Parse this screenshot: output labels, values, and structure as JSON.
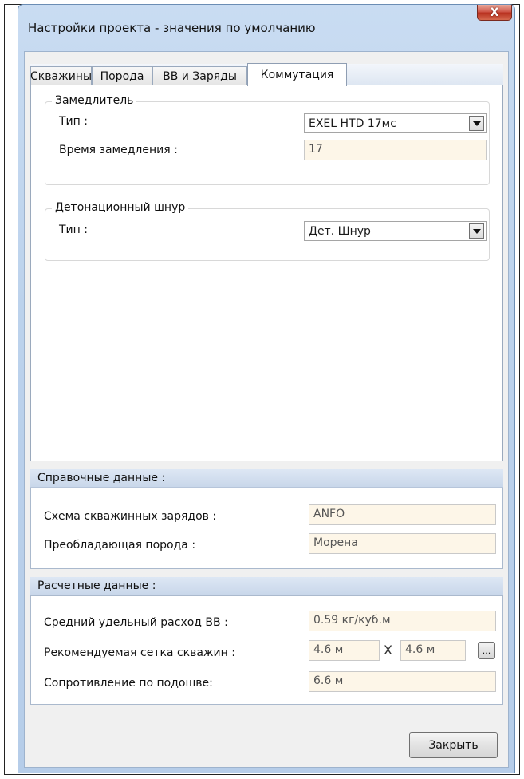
{
  "window": {
    "title": "Настройки проекта - значения по умолчанию",
    "close_glyph": "X"
  },
  "tabs": [
    {
      "label": "Скважины"
    },
    {
      "label": "Порода"
    },
    {
      "label": "ВВ и Заряды"
    },
    {
      "label": "Коммутация",
      "active": true
    }
  ],
  "delay_group": {
    "legend": "Замедлитель",
    "type_label": "Тип :",
    "type_value": "EXEL HTD 17мс",
    "delay_label": "Время замедления :",
    "delay_value": "17"
  },
  "cord_group": {
    "legend": "Детонационный шнур",
    "type_label": "Тип :",
    "type_value": "Дет. Шнур"
  },
  "reference": {
    "header": "Справочные  данные :",
    "charge_scheme_label": "Схема скважинных зарядов :",
    "charge_scheme_value": "ANFO",
    "rock_label": "Преобладающая порода :",
    "rock_value": "Морена"
  },
  "calculated": {
    "header": "Расчетные  данные :",
    "consumption_label": "Средний удельный расход ВВ :",
    "consumption_value": "0.59 кг/куб.м",
    "grid_label": "Рекомендуемая сетка скважин :",
    "grid_x_value": "4.6 м",
    "grid_separator": "X",
    "grid_y_value": "4.6 м",
    "grid_button": "...",
    "resistance_label": "Сопротивление по подошве:",
    "resistance_value": "6.6 м"
  },
  "footer": {
    "close_label": "Закрыть"
  },
  "icons": {
    "dropdown": "chevron-down-icon",
    "close": "close-icon"
  }
}
